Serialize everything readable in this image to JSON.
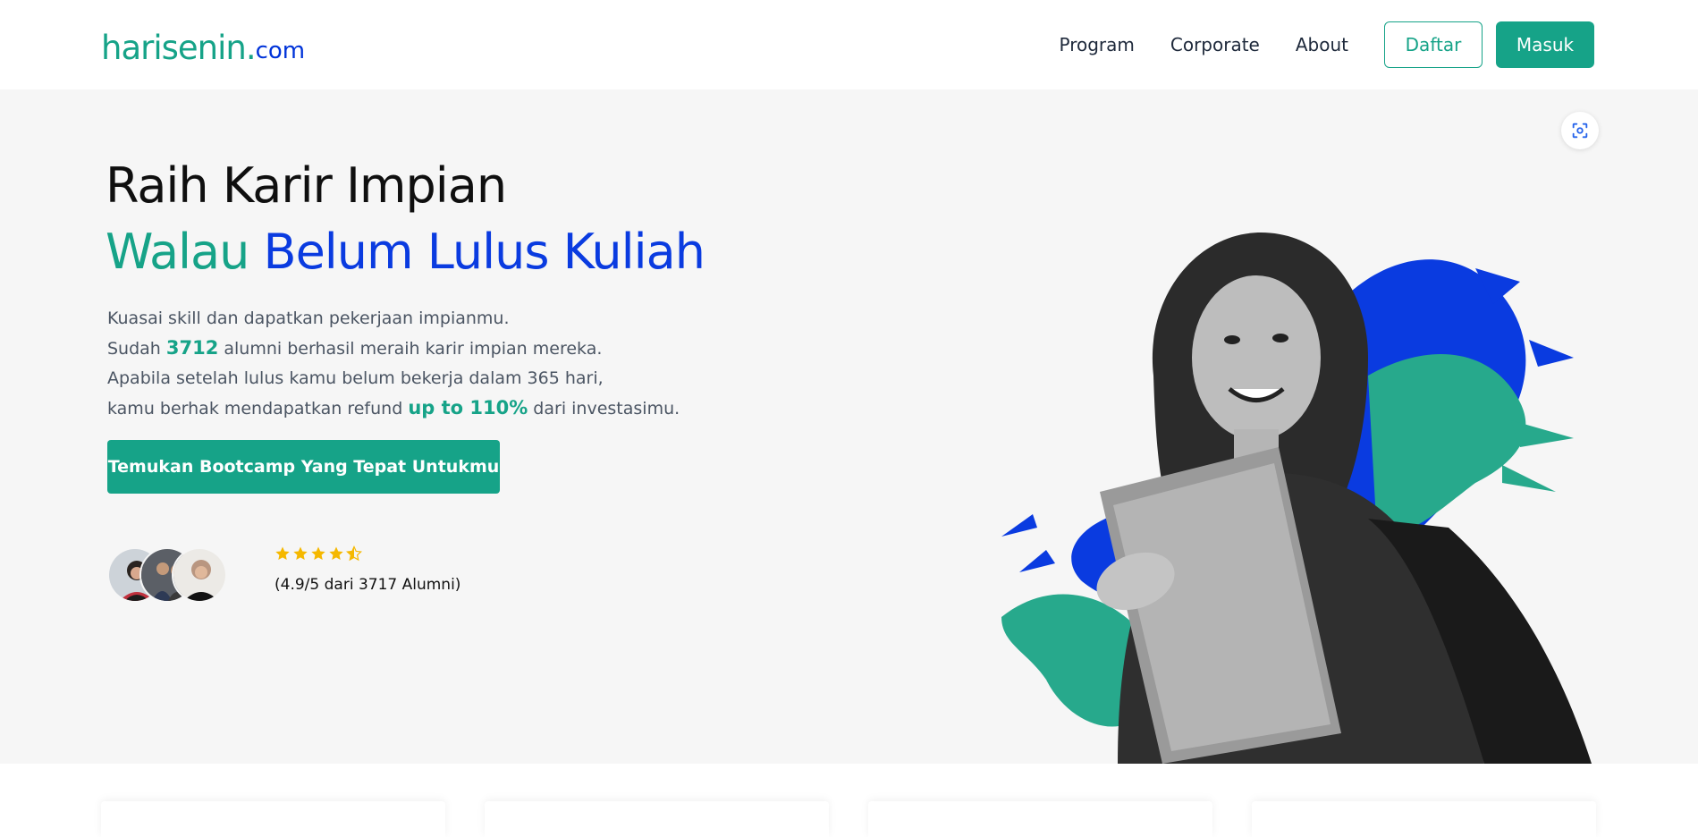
{
  "header": {
    "logo": {
      "brand": "harisenin",
      "tld": "com"
    },
    "nav": [
      "Program",
      "Corporate",
      "About"
    ],
    "register_label": "Daftar",
    "login_label": "Masuk"
  },
  "hero": {
    "title_line1": "Raih Karir Impian",
    "title_line2_green": "Walau",
    "title_line2_blue": "Belum Lulus Kuliah",
    "desc_line1": "Kuasai skill dan dapatkan pekerjaan impianmu.",
    "desc_line2_pre": "Sudah ",
    "desc_line2_num": "3712",
    "desc_line2_post": " alumni berhasil meraih karir impian mereka.",
    "desc_line3": "Apabila setelah lulus kamu belum bekerja dalam 365 hari,",
    "desc_line4_pre": "kamu berhak mendapatkan refund ",
    "desc_line4_hl": "up to 110%",
    "desc_line4_post": " dari investasimu.",
    "cta_label": "Temukan Bootcamp Yang Tepat Untukmu",
    "rating_stars": 4.5,
    "rating_text": "(4.9/5 dari 3717 Alumni)"
  },
  "colors": {
    "brand_green": "#16a388",
    "brand_blue": "#0a3be0",
    "star": "#f5b800",
    "hero_bg": "#f6f6f6"
  },
  "icons": [
    "focus-scan-icon",
    "star-icon",
    "star-half-icon"
  ]
}
